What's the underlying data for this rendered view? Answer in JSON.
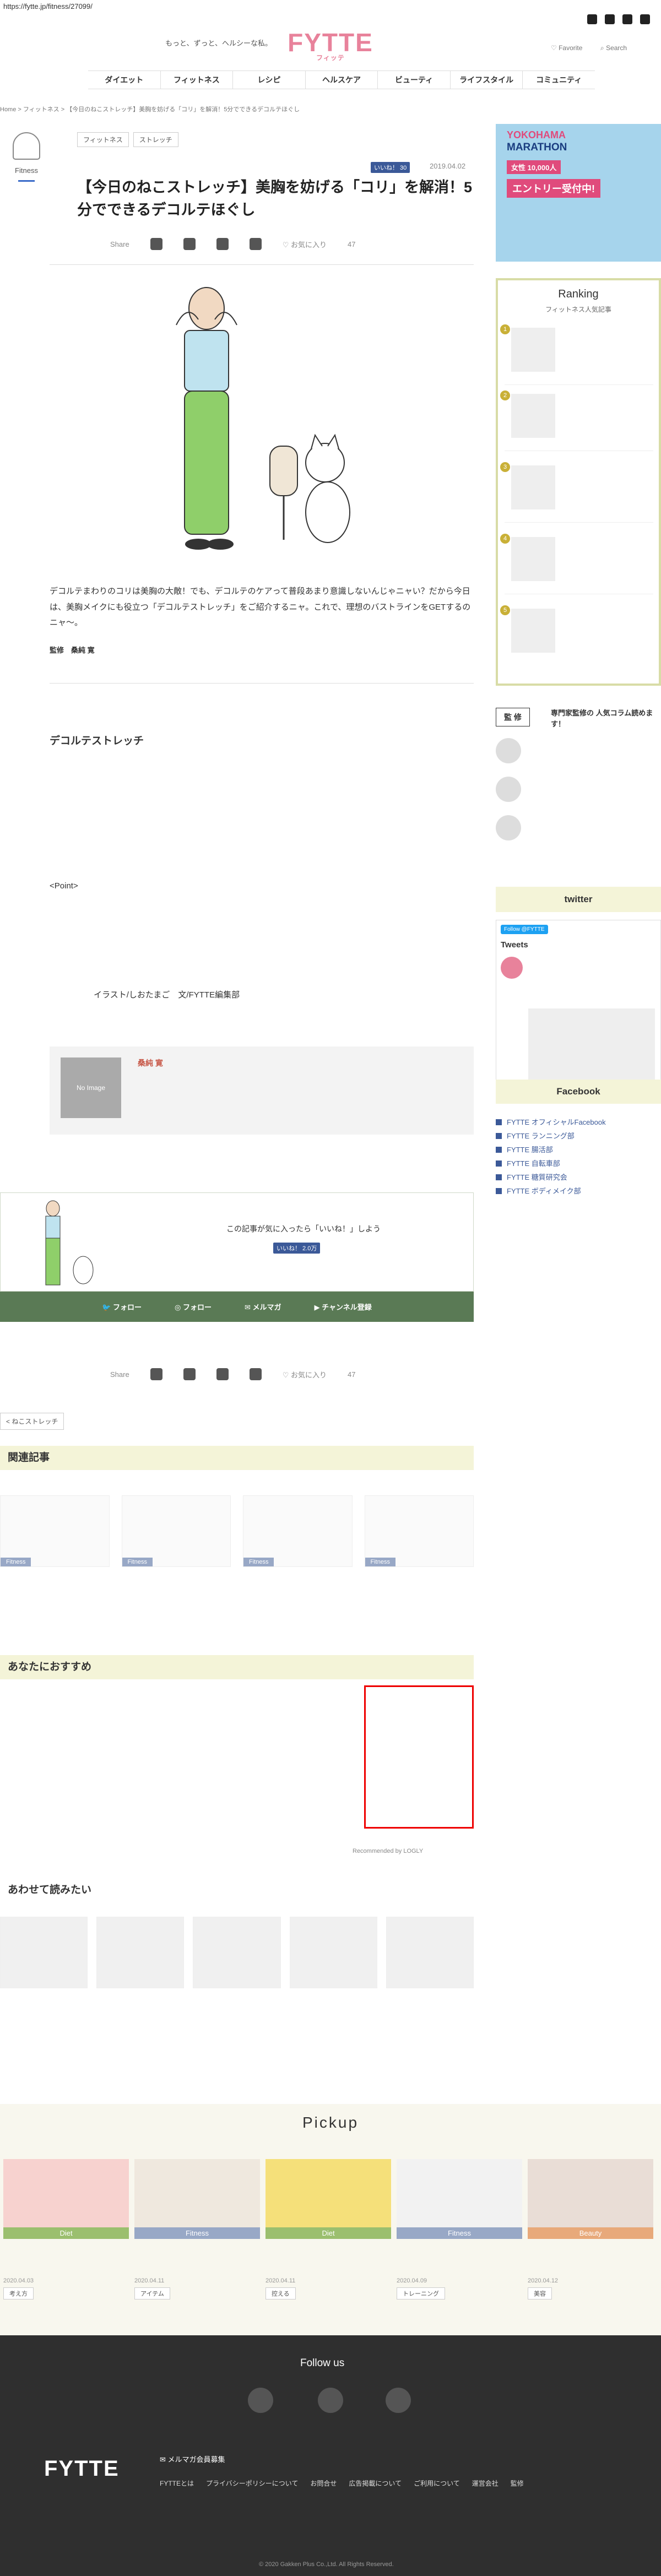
{
  "url": "https://fytte.jp/fitness/27099/",
  "header": {
    "tagline": "もっと、ずっと、ヘルシーな私。",
    "logo": "FYTTE",
    "logo_sub": "フィッテ",
    "favorite": "Favorite",
    "search": "Search"
  },
  "nav": [
    "ダイエット",
    "フィットネス",
    "レシピ",
    "ヘルスケア",
    "ビューティ",
    "ライフスタイル",
    "コミュニティ"
  ],
  "breadcrumb": "Home  >  フィットネス  >  【今日のねこストレッチ】美胸を妨げる「コリ」を解消！5分でできるデコルテほぐし",
  "article": {
    "category": "Fitness",
    "tags": [
      "フィットネス",
      "ストレッチ"
    ],
    "like_label": "いいね！ 30",
    "date": "2019.04.02",
    "title": "【今日のねこストレッチ】美胸を妨げる「コリ」を解消！5分でできるデコルテほぐし",
    "share": "Share",
    "fav": "お気に入り",
    "fav_count": "47",
    "intro": "デコルテまわりのコリは美胸の大敵！でも、デコルテのケアって普段あまり意識しないんじゃニャい？だから今日は、美胸メイクにも役立つ「デコルテストレッチ」をご紹介するニャ。これで、理想のバストラインをGETするのニャ〜。",
    "sup_label": "監修",
    "sup_name": "桑純 寛",
    "h2": "デコルテストレッチ",
    "body1": "",
    "point_label": "<Point>",
    "body2": "",
    "credit": "イラスト/しおたまご　文/FYTTE編集部",
    "profile_noimg": "No Image",
    "profile_name": "桑純 寛",
    "profile_text": "",
    "like_prompt": "この記事が気に入ったら「いいね！」しよう",
    "like_btn": "いいね！ 2.0万",
    "follow": [
      "フォロー",
      "フォロー",
      "メルマガ",
      "チャンネル登録"
    ],
    "back": "< ねこストレッチ"
  },
  "related": {
    "title": "関連記事",
    "items": [
      {
        "badge": "Fitness",
        "t": ""
      },
      {
        "badge": "Fitness",
        "t": ""
      },
      {
        "badge": "Fitness",
        "t": ""
      },
      {
        "badge": "Fitness",
        "t": ""
      }
    ]
  },
  "recommend": {
    "title": "あなたにおすすめ",
    "items": [
      {
        "t": "",
        "s": ""
      },
      {
        "t": "",
        "s": ""
      },
      {
        "t": "",
        "s": ""
      },
      {
        "t": "",
        "s": ""
      }
    ],
    "logly": "Recommended by LOGLY"
  },
  "alsoread": {
    "title": "あわせて読みたい",
    "items": [
      {
        "t": ""
      },
      {
        "t": ""
      },
      {
        "t": ""
      },
      {
        "t": ""
      },
      {
        "t": ""
      }
    ]
  },
  "pickup": {
    "title": "Pickup",
    "items": [
      {
        "cat": "Diet",
        "t": "",
        "d": "2020.04.03",
        "tag": "考え方"
      },
      {
        "cat": "Fitness",
        "t": "",
        "d": "2020.04.11",
        "tag": "アイテム"
      },
      {
        "cat": "Diet",
        "t": "",
        "d": "2020.04.11",
        "tag": "控える"
      },
      {
        "cat": "Fitness",
        "t": "",
        "d": "2020.04.09",
        "tag": "トレーニング"
      },
      {
        "cat": "Beauty",
        "t": "",
        "d": "2020.04.12",
        "tag": "美容"
      }
    ]
  },
  "footer": {
    "follow": "Follow us",
    "logo": "FYTTE",
    "mm": "メルマガ会員募集",
    "links": [
      "FYTTEとは",
      "プライバシーポリシーについて",
      "お問合せ",
      "広告掲載について",
      "ご利用について",
      "運営会社",
      "監修"
    ],
    "copy": "© 2020 Gakken Plus Co.,Ltd. All Rights Reserved."
  },
  "sidebar": {
    "ad": {
      "y": "YOKOHAMA",
      "m": "MARATHON",
      "b": "女性 10,000人",
      "e": "エントリー受付中!"
    },
    "ranking_title": "Ranking",
    "ranking_sub": "フィットネス人気記事",
    "ranking": [
      {
        "t": ""
      },
      {
        "t": ""
      },
      {
        "t": ""
      },
      {
        "t": ""
      },
      {
        "t": ""
      }
    ],
    "supervisor_box": "監 修",
    "supervisor_text": "専門家監修の 人気コラム読めます！",
    "supervisors": [
      {
        "nm": "",
        "ds": ""
      },
      {
        "nm": "",
        "ds": ""
      },
      {
        "nm": "",
        "ds": ""
      }
    ],
    "twitter": "twitter",
    "follow_btn": "Follow @FYTTE",
    "tweets": "Tweets",
    "tweet_acc": "",
    "tweet_text": "",
    "facebook": "Facebook",
    "fb_links": [
      "FYTTE オフィシャルFacebook",
      "FYTTE ランニング部",
      "FYTTE 腸活部",
      "FYTTE 自転車部",
      "FYTTE 糖質研究会",
      "FYTTE ボディメイク部"
    ]
  }
}
